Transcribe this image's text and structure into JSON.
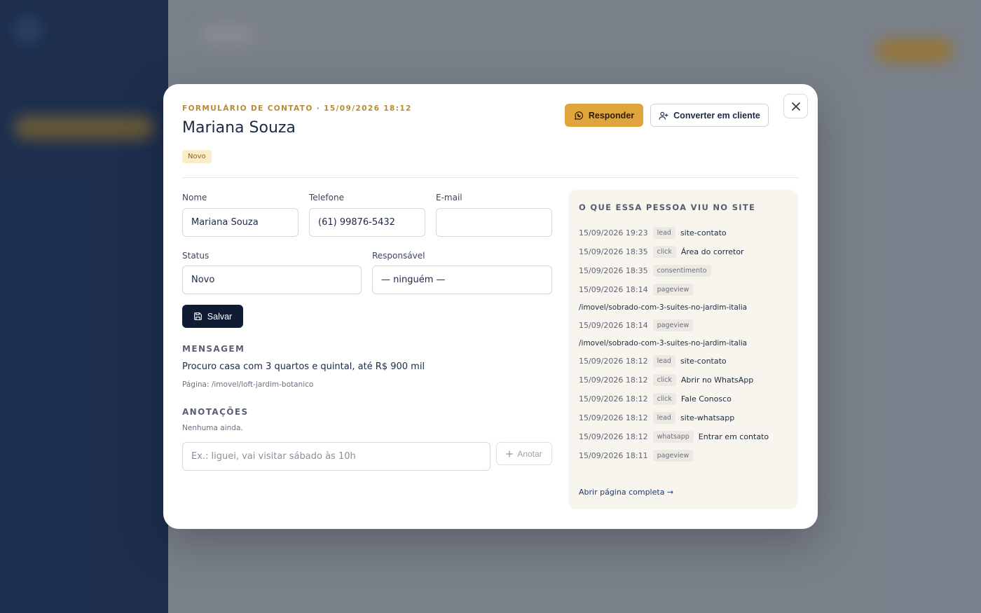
{
  "modal": {
    "eyebrow": "FORMULÁRIO DE CONTATO · 15/09/2026 18:12",
    "title": "Mariana Souza",
    "status_badge": "Novo",
    "reply_label": "Responder",
    "convert_label": "Converter em cliente"
  },
  "form": {
    "name_label": "Nome",
    "name_value": "Mariana Souza",
    "phone_label": "Telefone",
    "phone_value": "(61) 99876-5432",
    "email_label": "E-mail",
    "email_value": "",
    "status_label": "Status",
    "status_value": "Novo",
    "owner_label": "Responsável",
    "owner_value": "— ninguém —",
    "save_label": "Salvar"
  },
  "message": {
    "heading": "MENSAGEM",
    "text": "Procuro casa com 3 quartos e quintal, até R$ 900 mil",
    "page": "Página: /imovel/loft-jardim-botanico"
  },
  "notes": {
    "heading": "ANOTAÇÕES",
    "empty": "Nenhuma ainda.",
    "placeholder": "Ex.: liguei, vai visitar sábado às 10h",
    "add_label": "Anotar"
  },
  "activity": {
    "heading": "O QUE ESSA PESSOA VIU NO SITE",
    "items": [
      {
        "time": "15/09/2026 19:23",
        "tag": "lead",
        "label": "site-contato"
      },
      {
        "time": "15/09/2026 18:35",
        "tag": "click",
        "label": "Área do corretor"
      },
      {
        "time": "15/09/2026 18:35",
        "tag": "consentimento",
        "label": ""
      },
      {
        "time": "15/09/2026 18:14",
        "tag": "pageview",
        "label": "",
        "path": "/imovel/sobrado-com-3-suites-no-jardim-italia"
      },
      {
        "time": "15/09/2026 18:14",
        "tag": "pageview",
        "label": "",
        "path": "/imovel/sobrado-com-3-suites-no-jardim-italia"
      },
      {
        "time": "15/09/2026 18:12",
        "tag": "lead",
        "label": "site-contato"
      },
      {
        "time": "15/09/2026 18:12",
        "tag": "click",
        "label": "Abrir no WhatsApp"
      },
      {
        "time": "15/09/2026 18:12",
        "tag": "click",
        "label": "Fale Conosco"
      },
      {
        "time": "15/09/2026 18:12",
        "tag": "lead",
        "label": "site-whatsapp"
      },
      {
        "time": "15/09/2026 18:12",
        "tag": "whatsapp",
        "label": "Entrar em contato"
      },
      {
        "time": "15/09/2026 18:11",
        "tag": "pageview",
        "label": ""
      }
    ],
    "full_link": "Abrir página completa →"
  },
  "colors": {
    "accent": "#e0a43c",
    "eyebrow": "#b98a33",
    "primary_dark": "#0f1c33",
    "panel_bg": "#f8f5ee"
  }
}
